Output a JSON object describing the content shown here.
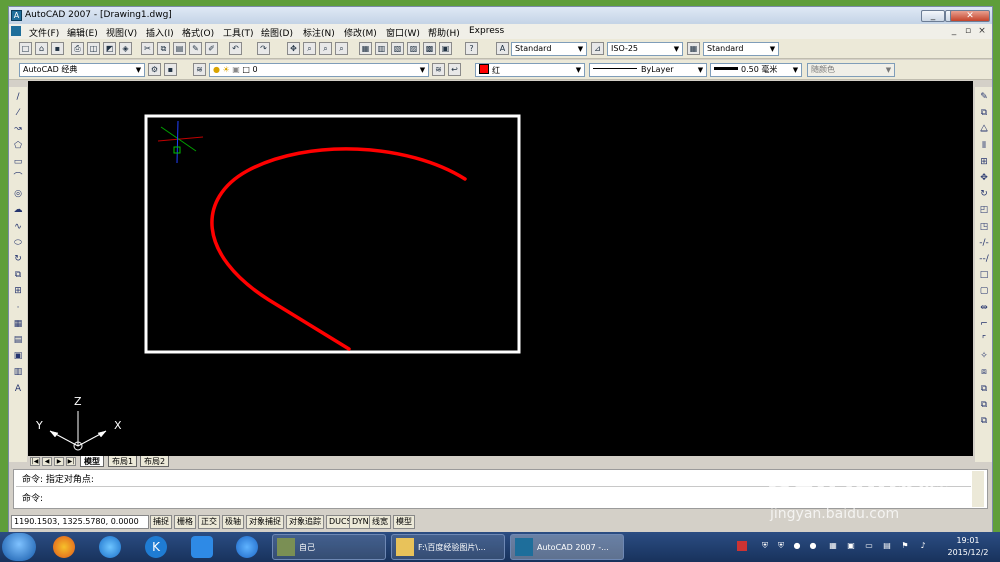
{
  "window": {
    "title": "AutoCAD 2007 - [Drawing1.dwg]",
    "min": "_",
    "max": "□",
    "close": "✕"
  },
  "menu": {
    "items": [
      "文件(F)",
      "编辑(E)",
      "视图(V)",
      "插入(I)",
      "格式(O)",
      "工具(T)",
      "绘图(D)",
      "标注(N)",
      "修改(M)",
      "窗口(W)",
      "帮助(H)",
      "Express"
    ]
  },
  "toolbar1": {
    "text_style": "Standard",
    "dim_style": "ISO-25",
    "table_style": "Standard"
  },
  "toolbar2": {
    "workspace": "AutoCAD 经典",
    "layer": "0",
    "color": "红",
    "linetype": "ByLayer",
    "lineweight": "0.50 毫米",
    "plot_style": "随颜色"
  },
  "draw_tools": [
    "/",
    "⁄",
    "↝",
    "⬠",
    "▭",
    "⌒",
    "◎",
    "☁",
    "∿",
    "⬭",
    "↻",
    "⧉",
    "⊞",
    "·",
    "▦",
    "▤",
    "▣",
    "▥",
    "A"
  ],
  "modify_tools": [
    "✎",
    "⧉",
    "⧋",
    "⫴",
    "⊞",
    "✥",
    "↻",
    "◰",
    "◳",
    "-/-",
    "--/",
    "□",
    "▢",
    "⇹",
    "⌐",
    "⌜",
    "✧",
    "⧈",
    "⧉",
    "⧉",
    "⧉"
  ],
  "ucs": {
    "x": "X",
    "y": "Y",
    "z": "Z"
  },
  "drawing": {
    "curve_color": "#ff0000",
    "frame_color": "#ffffff"
  },
  "layout_tabs": [
    "模型",
    "布局1",
    "布局2"
  ],
  "command": {
    "line1": "命令: 指定对角点:",
    "line2": "命令:"
  },
  "status": {
    "coords": "1190.1503, 1325.5780, 0.0000",
    "buttons": [
      "捕捉",
      "栅格",
      "正交",
      "极轴",
      "对象捕捉",
      "对象追踪",
      "DUCS",
      "DYN",
      "线宽",
      "模型"
    ]
  },
  "taskbar": {
    "tasks": [
      "自己",
      "F:\\百度经验图片\\...",
      "AutoCAD 2007 -..."
    ],
    "time": "19:01",
    "date": "2015/12/2"
  },
  "watermark": {
    "brand": "Bai",
    "brand2": "经验",
    "url": "jingyan.baidu.com"
  }
}
